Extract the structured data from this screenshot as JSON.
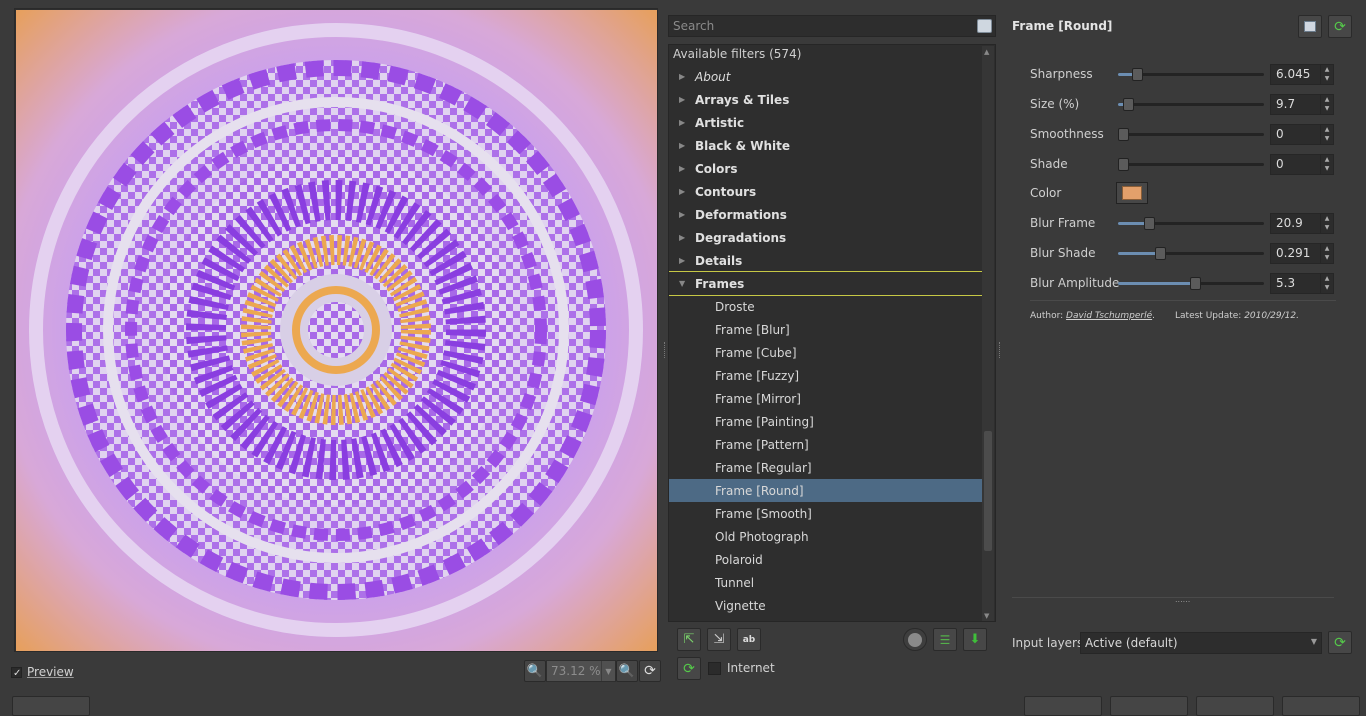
{
  "preview": {
    "checkbox_label": "Preview",
    "checked": true,
    "zoom": "73.12 %"
  },
  "search": {
    "placeholder": "Search"
  },
  "filters": {
    "header": "Available filters (574)",
    "categories": [
      {
        "label": "About",
        "italic": true
      },
      {
        "label": "Arrays & Tiles"
      },
      {
        "label": "Artistic"
      },
      {
        "label": "Black & White"
      },
      {
        "label": "Colors"
      },
      {
        "label": "Contours"
      },
      {
        "label": "Deformations"
      },
      {
        "label": "Degradations"
      },
      {
        "label": "Details"
      },
      {
        "label": "Frames",
        "expanded": true
      }
    ],
    "frames": [
      "Droste",
      "Frame [Blur]",
      "Frame [Cube]",
      "Frame [Fuzzy]",
      "Frame [Mirror]",
      "Frame [Painting]",
      "Frame [Pattern]",
      "Frame [Regular]",
      "Frame [Round]",
      "Frame [Smooth]",
      "Old Photograph",
      "Polaroid",
      "Tunnel",
      "Vignette"
    ],
    "selected": "Frame [Round]"
  },
  "internet": {
    "label": "Internet",
    "checked": false
  },
  "filter_panel": {
    "title": "Frame [Round]",
    "params": [
      {
        "label": "Sharpness",
        "value": "6.045",
        "level": 0.13
      },
      {
        "label": "Size (%)",
        "value": "9.7",
        "level": 0.07
      },
      {
        "label": "Smoothness",
        "value": "0",
        "level": 0.0
      },
      {
        "label": "Shade",
        "value": "0",
        "level": 0.0
      },
      {
        "label": "Blur Frame",
        "value": "20.9",
        "level": 0.21
      },
      {
        "label": "Blur Shade",
        "value": "0.291",
        "level": 0.29
      },
      {
        "label": "Blur Amplitude",
        "value": "5.3",
        "level": 0.53
      }
    ],
    "color": {
      "label": "Color",
      "value": "#e3a06b"
    },
    "author_prefix": "Author: ",
    "author_name": "David Tschumperlé",
    "update_prefix": "Latest Update: ",
    "update_date": "2010/29/12",
    "resize_grip": "......"
  },
  "input_layers": {
    "label": "Input layers",
    "value": "Active (default)"
  }
}
